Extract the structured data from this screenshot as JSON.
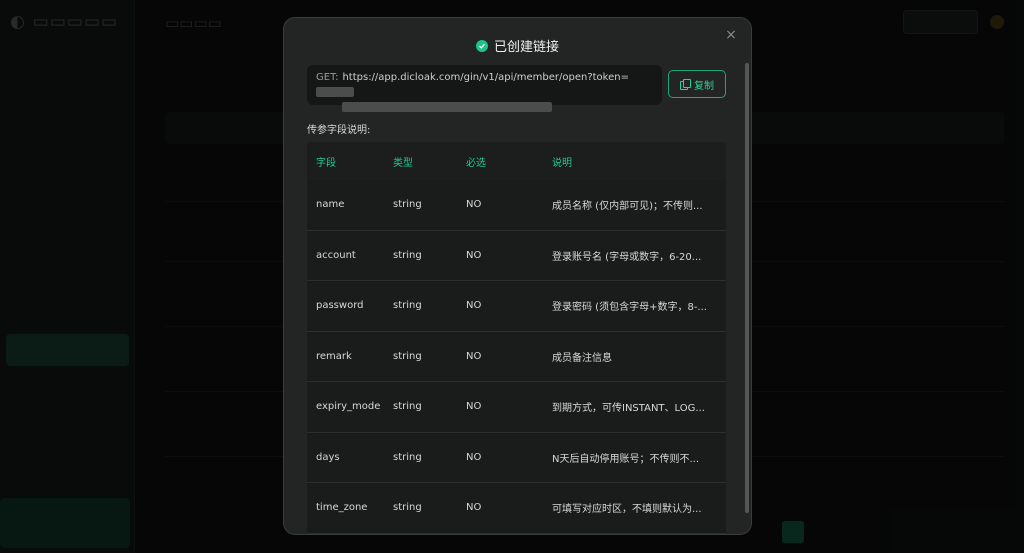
{
  "modal": {
    "title": "已创建链接",
    "close": "×",
    "url_method": "GET:",
    "url_value": "https://app.dicloak.com/gin/v1/api/member/open?token=",
    "copy_label": "复制",
    "section_label": "传参字段说明:"
  },
  "table": {
    "headers": [
      "字段",
      "类型",
      "必选",
      "说明"
    ],
    "rows": [
      {
        "field": "name",
        "type": "string",
        "required": "NO",
        "desc": "成员名称 (仅内部可见)；不传则..."
      },
      {
        "field": "account",
        "type": "string",
        "required": "NO",
        "desc": "登录账号名 (字母或数字，6-20..."
      },
      {
        "field": "password",
        "type": "string",
        "required": "NO",
        "desc": "登录密码 (须包含字母+数字，8-..."
      },
      {
        "field": "remark",
        "type": "string",
        "required": "NO",
        "desc": "成员备注信息"
      },
      {
        "field": "expiry_mode",
        "type": "string",
        "required": "NO",
        "desc": "到期方式，可传INSTANT、LOG..."
      },
      {
        "field": "days",
        "type": "string",
        "required": "NO",
        "desc": "N天后自动停用账号；不传则不..."
      },
      {
        "field": "time_zone",
        "type": "string",
        "required": "NO",
        "desc": "可填写对应时区，不填则默认为..."
      }
    ]
  },
  "colors": {
    "accent": "#21c990",
    "modal_bg": "#232424",
    "page_bg": "#0b0c0c"
  }
}
